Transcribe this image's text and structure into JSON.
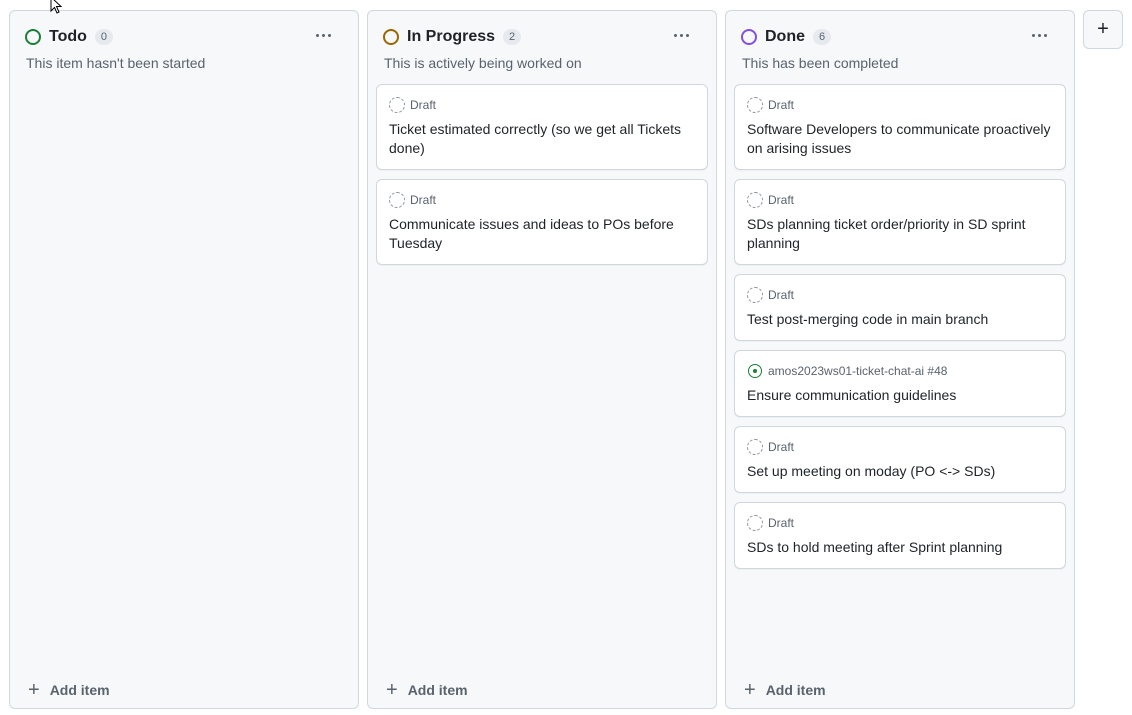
{
  "columns": [
    {
      "title": "Todo",
      "count": "0",
      "description": "This item hasn't been started",
      "status_color": "#1a7f37",
      "add_label": "Add item",
      "cards": []
    },
    {
      "title": "In Progress",
      "count": "2",
      "description": "This is actively being worked on",
      "status_color": "#9a6700",
      "add_label": "Add item",
      "cards": [
        {
          "meta": "Draft",
          "title": "Ticket estimated correctly (so we get all Tickets done)"
        },
        {
          "meta": "Draft",
          "title": "Communicate issues and ideas to POs before Tuesday"
        }
      ]
    },
    {
      "title": "Done",
      "count": "6",
      "description": "This has been completed",
      "status_color": "#8250df",
      "add_label": "Add item",
      "cards": [
        {
          "meta": "Draft",
          "title": "Software Developers to communicate proactively on arising issues"
        },
        {
          "meta": "Draft",
          "title": "SDs planning ticket order/priority in SD sprint planning"
        },
        {
          "meta": "Draft",
          "title": "Test post-merging code in main branch"
        },
        {
          "meta": "amos2023ws01-ticket-chat-ai #48",
          "title": "Ensure communication guidelines"
        },
        {
          "meta": "Draft",
          "title": "Set up meeting on moday (PO <-> SDs)"
        },
        {
          "meta": "Draft",
          "title": "SDs to hold meeting after Sprint planning"
        }
      ]
    }
  ],
  "add_column_label": "+",
  "icons": {
    "draft": "draft-circle-icon",
    "issue": "open-issue-icon",
    "menu": "kebab-menu-icon",
    "add": "plus-icon"
  }
}
